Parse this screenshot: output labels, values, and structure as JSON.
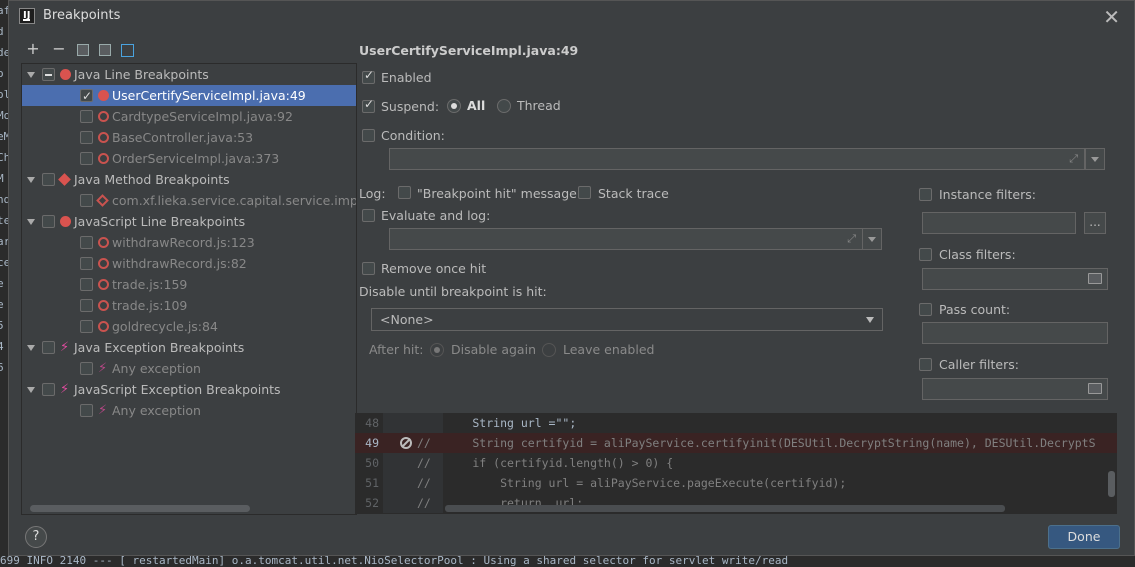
{
  "window": {
    "title": "Breakpoints",
    "close_glyph": "✕"
  },
  "toolbar": {
    "add": "+",
    "remove": "−"
  },
  "tree": [
    {
      "label": "Java Line Breakpoints",
      "level": 0,
      "icon": "red-dot-icon",
      "check": "mixed",
      "group": true
    },
    {
      "label": "UserCertifyServiceImpl.java:49",
      "level": 1,
      "icon": "red-dot-icon",
      "check": "checked",
      "selected": true
    },
    {
      "label": "CardtypeServiceImpl.java:92",
      "level": 1,
      "icon": "red-ring-icon",
      "check": "none"
    },
    {
      "label": "BaseController.java:53",
      "level": 1,
      "icon": "red-ring-icon",
      "check": "none"
    },
    {
      "label": "OrderServiceImpl.java:373",
      "level": 1,
      "icon": "red-ring-icon",
      "check": "none"
    },
    {
      "label": "Java Method Breakpoints",
      "level": 0,
      "icon": "red-diamond-icon",
      "check": "none",
      "group": true
    },
    {
      "label": "com.xf.lieka.service.capital.service.impl.Fund",
      "level": 1,
      "icon": "red-diamond-ring-icon",
      "check": "none"
    },
    {
      "label": "JavaScript Line Breakpoints",
      "level": 0,
      "icon": "red-dot-icon",
      "check": "none",
      "group": true
    },
    {
      "label": "withdrawRecord.js:123",
      "level": 1,
      "icon": "red-ring-icon",
      "check": "none"
    },
    {
      "label": "withdrawRecord.js:82",
      "level": 1,
      "icon": "red-ring-icon",
      "check": "none"
    },
    {
      "label": "trade.js:159",
      "level": 1,
      "icon": "red-ring-icon",
      "check": "none"
    },
    {
      "label": "trade.js:109",
      "level": 1,
      "icon": "red-ring-icon",
      "check": "none"
    },
    {
      "label": "goldrecycle.js:84",
      "level": 1,
      "icon": "red-ring-icon",
      "check": "none"
    },
    {
      "label": "Java Exception Breakpoints",
      "level": 0,
      "icon": "lightning-icon",
      "check": "none",
      "group": true
    },
    {
      "label": "Any exception",
      "level": 1,
      "icon": "lightning-icon",
      "check": "none"
    },
    {
      "label": "JavaScript Exception Breakpoints",
      "level": 0,
      "icon": "lightning-icon",
      "check": "none",
      "group": true
    },
    {
      "label": "Any exception",
      "level": 1,
      "icon": "lightning-icon",
      "check": "none"
    }
  ],
  "details": {
    "title": "UserCertifyServiceImpl.java:49",
    "enabled_label": "Enabled",
    "suspend_label": "Suspend:",
    "suspend_all": "All",
    "suspend_thread": "Thread",
    "condition_label": "Condition:",
    "log_label": "Log:",
    "log_message": "\"Breakpoint hit\" message",
    "log_stack": "Stack trace",
    "evaluate_label": "Evaluate and log:",
    "remove_once": "Remove once hit",
    "disable_until": "Disable until breakpoint is hit:",
    "disable_value": "<None>",
    "after_hit": "After hit:",
    "disable_again": "Disable again",
    "leave_enabled": "Leave enabled",
    "instance_filters": "Instance filters:",
    "instance_btn": "...",
    "class_filters": "Class filters:",
    "pass_count": "Pass count:",
    "caller_filters": "Caller filters:"
  },
  "code": [
    {
      "num": "48",
      "text": "        String url =\"\";",
      "bp": false
    },
    {
      "num": "49",
      "text": "//      String certifyid = aliPayService.certifyinit(DESUtil.DecryptString(name), DESUtil.DecryptS",
      "bp": true
    },
    {
      "num": "50",
      "text": "//      if (certifyid.length() > 0) {",
      "bp": false
    },
    {
      "num": "51",
      "text": "//          String url = aliPayService.pageExecute(certifyid);",
      "bp": false
    },
    {
      "num": "52",
      "text": "//          return  url;",
      "bp": false
    }
  ],
  "footer": {
    "help": "?",
    "done": "Done"
  },
  "background": {
    "left_chars": [
      "af",
      "",
      "d",
      "de",
      "",
      "",
      "o",
      "ol",
      "",
      "Mo",
      "eM",
      "Ch",
      "M",
      "nd",
      "te",
      "ar",
      "ce",
      "",
      "e",
      "",
      "e",
      "",
      "5",
      "",
      "4",
      "",
      "6",
      "",
      ""
    ],
    "bottom_line": "699  INFO 2140 --- [  restartedMain] o.a.tomcat.util.net.NioSelectorPool       : Using a shared selector for servlet write/read"
  }
}
